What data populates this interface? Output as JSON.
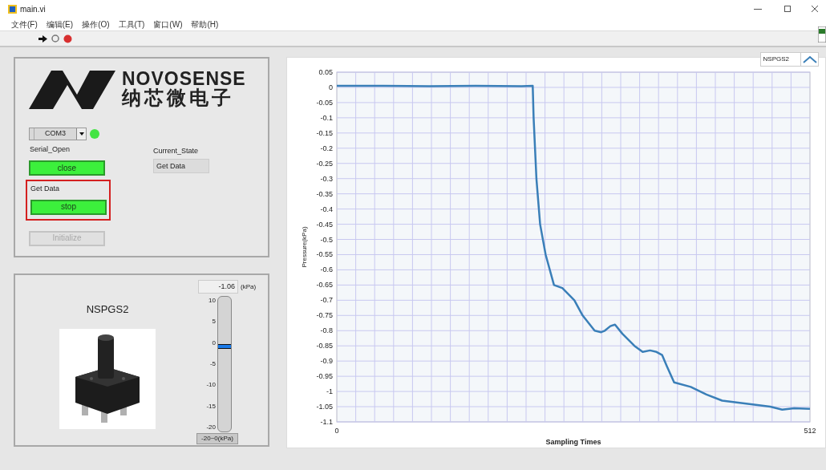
{
  "window": {
    "title": "main.vi"
  },
  "menu": [
    "文件(F)",
    "编辑(E)",
    "操作(O)",
    "工具(T)",
    "窗口(W)",
    "帮助(H)"
  ],
  "logo": {
    "name": "NOVOSENSE",
    "subtitle": "纳芯微电子"
  },
  "port": {
    "value": "COM3",
    "led_on": true
  },
  "serial_open": {
    "label": "Serial_Open",
    "button": "close",
    "on": true
  },
  "current_state": {
    "label": "Current_State",
    "value": "Get Data"
  },
  "get_data": {
    "label": "Get Data",
    "button": "stop",
    "on": true,
    "highlighted": true
  },
  "initialize": {
    "button": "Initialize",
    "disabled": true
  },
  "sensor": {
    "title": "NSPGS2"
  },
  "gauge": {
    "reading": "-1.06",
    "unit": "(kPa)",
    "scale": [
      "10",
      "5",
      "0",
      "-5",
      "-10",
      "-15",
      "-20"
    ],
    "level": 0.631,
    "range": "-20~0(kPa)"
  },
  "chart": {
    "chart_data": {
      "type": "line",
      "grid": true,
      "xlabel": "Sampling Times",
      "ylabel": "Pressure(kPa)",
      "xlim": [
        0,
        512
      ],
      "ylim": [
        -1.1,
        0.05
      ],
      "xticks": [
        0,
        512
      ],
      "yticks": [
        0.05,
        0,
        -0.05,
        -0.1,
        -0.15,
        -0.2,
        -0.25,
        -0.3,
        -0.35,
        -0.4,
        -0.45,
        -0.5,
        -0.55,
        -0.6,
        -0.65,
        -0.7,
        -0.75,
        -0.8,
        -0.85,
        -0.9,
        -0.95,
        -1,
        -1.05,
        -1.1
      ],
      "x": [
        0,
        50,
        100,
        150,
        200,
        212,
        213,
        216,
        220,
        226,
        235,
        244,
        257,
        266,
        279,
        286,
        290,
        296,
        301,
        309,
        322,
        331,
        339,
        346,
        352,
        357,
        365,
        383,
        400,
        417,
        443,
        469,
        482,
        495,
        512
      ],
      "series": [
        {
          "name": "NSPGS2",
          "color": "#3a7fb8",
          "values": [
            0.005,
            0.005,
            0.004,
            0.005,
            0.004,
            0.005,
            -0.1,
            -0.3,
            -0.45,
            -0.55,
            -0.65,
            -0.66,
            -0.7,
            -0.75,
            -0.8,
            -0.805,
            -0.8,
            -0.785,
            -0.78,
            -0.81,
            -0.85,
            -0.87,
            -0.865,
            -0.87,
            -0.88,
            -0.916,
            -0.97,
            -0.985,
            -1.01,
            -1.03,
            -1.04,
            -1.05,
            -1.06,
            -1.055,
            -1.057
          ]
        }
      ]
    }
  }
}
